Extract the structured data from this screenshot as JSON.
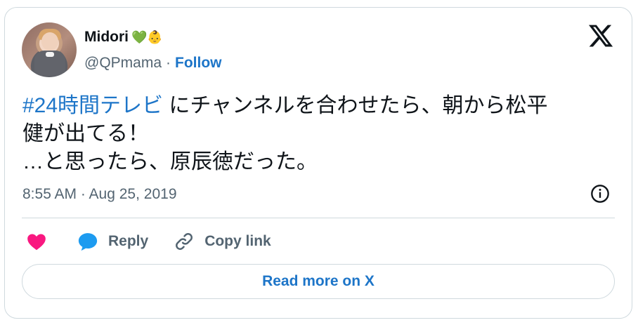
{
  "user": {
    "name": "Midori",
    "emoji": "💚👶",
    "handle": "@QPmama",
    "separator": "·",
    "follow_label": "Follow"
  },
  "tweet": {
    "hashtag": "#24時間テレビ",
    "text_part1": " にチャンネルを合わせたら、朝から松平",
    "text_line2": "健が出てる！",
    "text_line3": "…と思ったら、原辰徳だった。",
    "timestamp": "8:55 AM · Aug 25, 2019"
  },
  "actions": {
    "reply_label": "Reply",
    "copy_link_label": "Copy link"
  },
  "read_more_label": "Read more on X",
  "icons": {
    "logo": "x-logo-icon",
    "info": "info-icon",
    "like": "heart-icon",
    "reply": "reply-bubble-icon",
    "copy": "link-icon"
  },
  "colors": {
    "accent": "#1d75c8",
    "heart": "#f91880",
    "text": "#0f1419",
    "muted": "#536471",
    "border": "#cfd9de"
  }
}
